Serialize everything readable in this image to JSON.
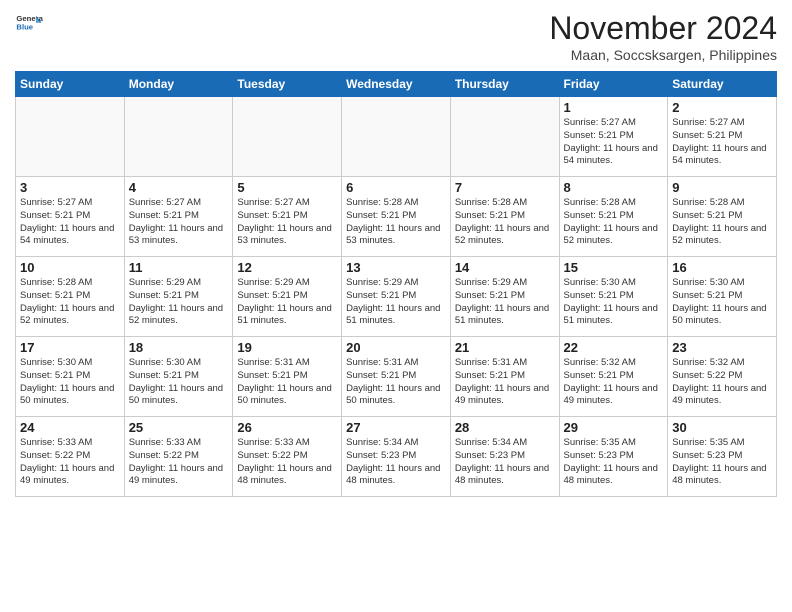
{
  "logo": {
    "general": "General",
    "blue": "Blue"
  },
  "header": {
    "month": "November 2024",
    "location": "Maan, Soccsksargen, Philippines"
  },
  "weekdays": [
    "Sunday",
    "Monday",
    "Tuesday",
    "Wednesday",
    "Thursday",
    "Friday",
    "Saturday"
  ],
  "weeks": [
    [
      {
        "day": "",
        "info": ""
      },
      {
        "day": "",
        "info": ""
      },
      {
        "day": "",
        "info": ""
      },
      {
        "day": "",
        "info": ""
      },
      {
        "day": "",
        "info": ""
      },
      {
        "day": "1",
        "info": "Sunrise: 5:27 AM\nSunset: 5:21 PM\nDaylight: 11 hours and 54 minutes."
      },
      {
        "day": "2",
        "info": "Sunrise: 5:27 AM\nSunset: 5:21 PM\nDaylight: 11 hours and 54 minutes."
      }
    ],
    [
      {
        "day": "3",
        "info": "Sunrise: 5:27 AM\nSunset: 5:21 PM\nDaylight: 11 hours and 54 minutes."
      },
      {
        "day": "4",
        "info": "Sunrise: 5:27 AM\nSunset: 5:21 PM\nDaylight: 11 hours and 53 minutes."
      },
      {
        "day": "5",
        "info": "Sunrise: 5:27 AM\nSunset: 5:21 PM\nDaylight: 11 hours and 53 minutes."
      },
      {
        "day": "6",
        "info": "Sunrise: 5:28 AM\nSunset: 5:21 PM\nDaylight: 11 hours and 53 minutes."
      },
      {
        "day": "7",
        "info": "Sunrise: 5:28 AM\nSunset: 5:21 PM\nDaylight: 11 hours and 52 minutes."
      },
      {
        "day": "8",
        "info": "Sunrise: 5:28 AM\nSunset: 5:21 PM\nDaylight: 11 hours and 52 minutes."
      },
      {
        "day": "9",
        "info": "Sunrise: 5:28 AM\nSunset: 5:21 PM\nDaylight: 11 hours and 52 minutes."
      }
    ],
    [
      {
        "day": "10",
        "info": "Sunrise: 5:28 AM\nSunset: 5:21 PM\nDaylight: 11 hours and 52 minutes."
      },
      {
        "day": "11",
        "info": "Sunrise: 5:29 AM\nSunset: 5:21 PM\nDaylight: 11 hours and 52 minutes."
      },
      {
        "day": "12",
        "info": "Sunrise: 5:29 AM\nSunset: 5:21 PM\nDaylight: 11 hours and 51 minutes."
      },
      {
        "day": "13",
        "info": "Sunrise: 5:29 AM\nSunset: 5:21 PM\nDaylight: 11 hours and 51 minutes."
      },
      {
        "day": "14",
        "info": "Sunrise: 5:29 AM\nSunset: 5:21 PM\nDaylight: 11 hours and 51 minutes."
      },
      {
        "day": "15",
        "info": "Sunrise: 5:30 AM\nSunset: 5:21 PM\nDaylight: 11 hours and 51 minutes."
      },
      {
        "day": "16",
        "info": "Sunrise: 5:30 AM\nSunset: 5:21 PM\nDaylight: 11 hours and 50 minutes."
      }
    ],
    [
      {
        "day": "17",
        "info": "Sunrise: 5:30 AM\nSunset: 5:21 PM\nDaylight: 11 hours and 50 minutes."
      },
      {
        "day": "18",
        "info": "Sunrise: 5:30 AM\nSunset: 5:21 PM\nDaylight: 11 hours and 50 minutes."
      },
      {
        "day": "19",
        "info": "Sunrise: 5:31 AM\nSunset: 5:21 PM\nDaylight: 11 hours and 50 minutes."
      },
      {
        "day": "20",
        "info": "Sunrise: 5:31 AM\nSunset: 5:21 PM\nDaylight: 11 hours and 50 minutes."
      },
      {
        "day": "21",
        "info": "Sunrise: 5:31 AM\nSunset: 5:21 PM\nDaylight: 11 hours and 49 minutes."
      },
      {
        "day": "22",
        "info": "Sunrise: 5:32 AM\nSunset: 5:21 PM\nDaylight: 11 hours and 49 minutes."
      },
      {
        "day": "23",
        "info": "Sunrise: 5:32 AM\nSunset: 5:22 PM\nDaylight: 11 hours and 49 minutes."
      }
    ],
    [
      {
        "day": "24",
        "info": "Sunrise: 5:33 AM\nSunset: 5:22 PM\nDaylight: 11 hours and 49 minutes."
      },
      {
        "day": "25",
        "info": "Sunrise: 5:33 AM\nSunset: 5:22 PM\nDaylight: 11 hours and 49 minutes."
      },
      {
        "day": "26",
        "info": "Sunrise: 5:33 AM\nSunset: 5:22 PM\nDaylight: 11 hours and 48 minutes."
      },
      {
        "day": "27",
        "info": "Sunrise: 5:34 AM\nSunset: 5:23 PM\nDaylight: 11 hours and 48 minutes."
      },
      {
        "day": "28",
        "info": "Sunrise: 5:34 AM\nSunset: 5:23 PM\nDaylight: 11 hours and 48 minutes."
      },
      {
        "day": "29",
        "info": "Sunrise: 5:35 AM\nSunset: 5:23 PM\nDaylight: 11 hours and 48 minutes."
      },
      {
        "day": "30",
        "info": "Sunrise: 5:35 AM\nSunset: 5:23 PM\nDaylight: 11 hours and 48 minutes."
      }
    ]
  ]
}
